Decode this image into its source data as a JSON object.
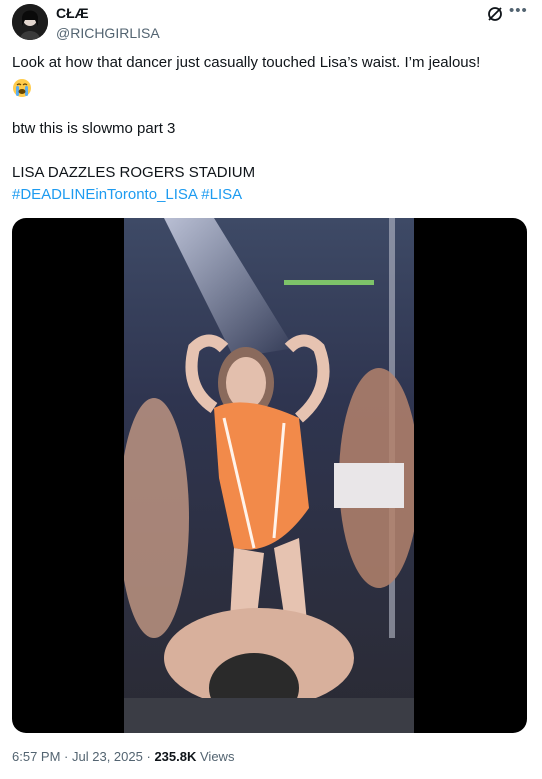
{
  "author": {
    "display_name": "CŁÆ",
    "handle": "@RICHGIRLISA"
  },
  "tweet": {
    "text_line1": "Look at how that dancer just casually touched Lisa’s waist. I’m jealous!",
    "emoji": "loudly-crying-face",
    "text_line2": "btw this is slowmo part 3",
    "text_line3": "LISA DAZZLES ROGERS STADIUM",
    "hashtag1": "#DEADLINEinToronto_LISA",
    "hashtag2": "#LISA"
  },
  "meta": {
    "time": "6:57 PM",
    "separator1": "·",
    "date": "Jul 23, 2025",
    "separator2": "·",
    "views_count": "235.8K",
    "views_label": "Views"
  },
  "colors": {
    "link": "#1d9bf0",
    "secondary_text": "#536471",
    "primary_text": "#0f1419"
  }
}
